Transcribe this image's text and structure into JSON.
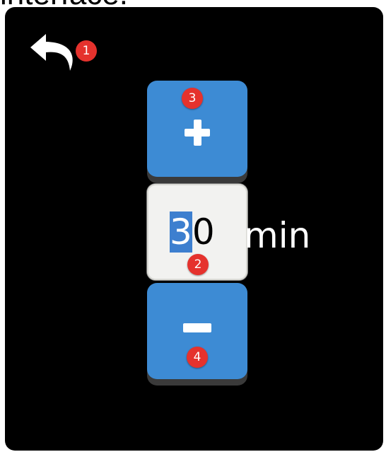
{
  "caption": {
    "text": "interface."
  },
  "toolbar": {
    "back_icon": "undo-arrow-icon"
  },
  "timer": {
    "increment_icon": "plus-icon",
    "decrement_icon": "minus-icon",
    "value": {
      "selected_part": "3",
      "rest_part": "0"
    },
    "unit": "min"
  },
  "annotations": {
    "back": "1",
    "value_field": "2",
    "increment": "3",
    "decrement": "4"
  },
  "colors": {
    "screen_background": "#000000",
    "button_blue": "#3d8bd4",
    "marker_red": "#e5322d",
    "field_background": "#f2f2f0",
    "selection_blue": "#3d7fcf"
  }
}
